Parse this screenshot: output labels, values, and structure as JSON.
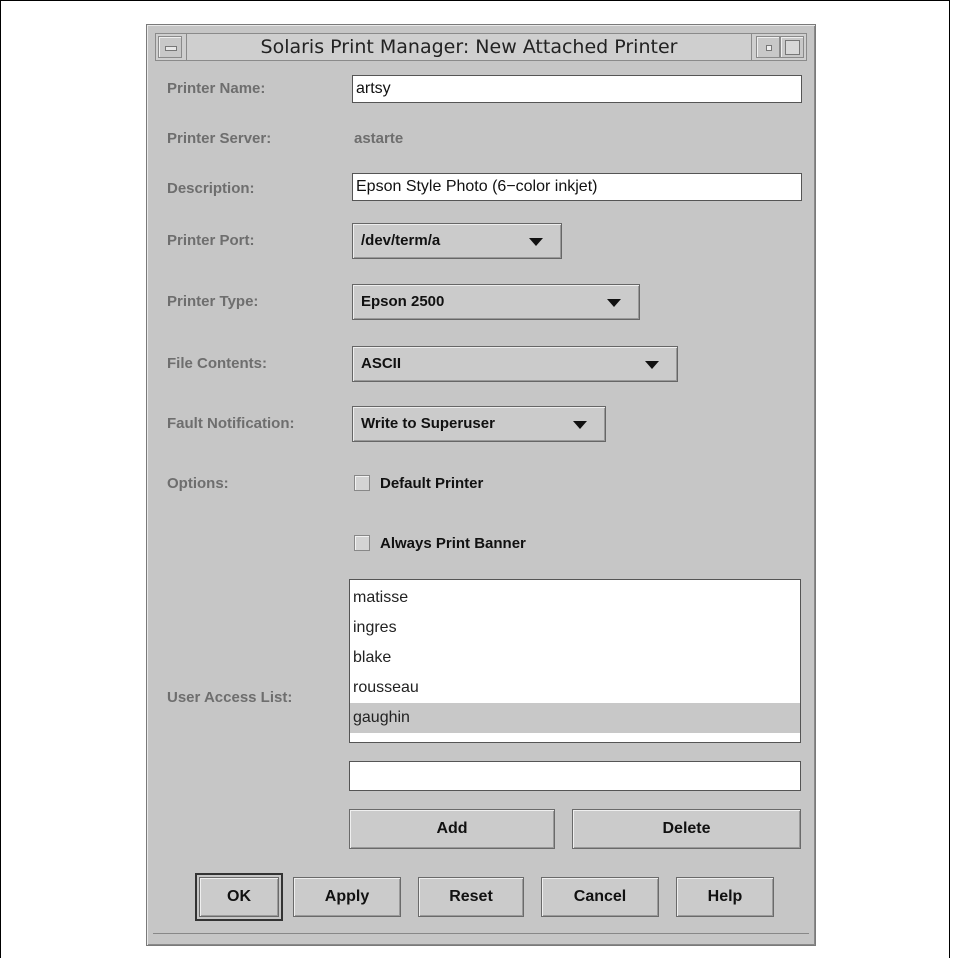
{
  "window": {
    "title": "Solaris Print Manager: New Attached Printer"
  },
  "form": {
    "printer_name": {
      "label": "Printer Name:",
      "value": "artsy"
    },
    "printer_server": {
      "label": "Printer Server:",
      "value": "astarte"
    },
    "description": {
      "label": "Description:",
      "value": "Epson Style Photo (6−color inkjet)"
    },
    "printer_port": {
      "label": "Printer Port:",
      "value": "/dev/term/a"
    },
    "printer_type": {
      "label": "Printer Type:",
      "value": "Epson 2500"
    },
    "file_contents": {
      "label": "File Contents:",
      "value": "ASCII"
    },
    "fault_notification": {
      "label": "Fault Notification:",
      "value": "Write to Superuser"
    },
    "options": {
      "label": "Options:",
      "default_printer": {
        "label": "Default Printer",
        "checked": false
      },
      "always_print_banner": {
        "label": "Always Print Banner",
        "checked": false
      }
    },
    "user_access_list": {
      "label": "User Access List:",
      "items": [
        "matisse",
        "ingres",
        "blake",
        "rousseau",
        "gaughin"
      ],
      "selected": "gaughin",
      "entry_value": "",
      "add_label": "Add",
      "delete_label": "Delete"
    }
  },
  "buttons": {
    "ok": "OK",
    "apply": "Apply",
    "reset": "Reset",
    "cancel": "Cancel",
    "help": "Help"
  }
}
